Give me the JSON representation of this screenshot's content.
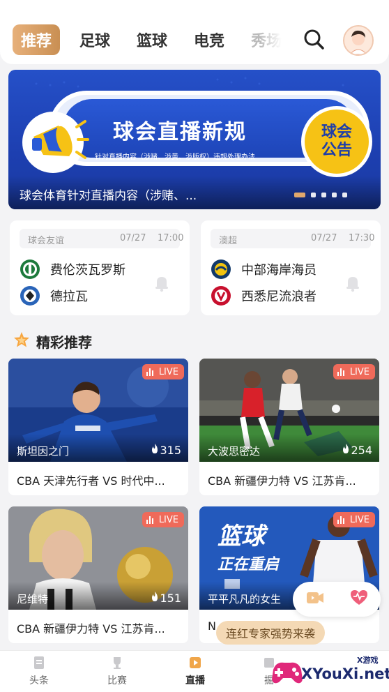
{
  "top_tabs": [
    "推荐",
    "足球",
    "篮球",
    "电竞",
    "秀场"
  ],
  "banner": {
    "title": "球会直播新规",
    "subtitle": "针对直播内容（涉赌、涉黄、涉版权）违规处理办法",
    "badge_line1": "球会",
    "badge_line2": "公告",
    "caption": "球会体育针对直播内容（涉赌、..."
  },
  "matches": [
    {
      "league": "球会友谊",
      "date": "07/27",
      "time": "17:00",
      "home": "费伦茨瓦罗斯",
      "away": "德拉瓦"
    },
    {
      "league": "澳超",
      "date": "07/27",
      "time": "17:30",
      "home": "中部海岸海员",
      "away": "西悉尼流浪者"
    }
  ],
  "section_title": "精彩推荐",
  "live_label": "LIVE",
  "videos": [
    {
      "anchor": "斯坦因之门",
      "heat": "315",
      "title": "CBA 天津先行者 VS 时代中..."
    },
    {
      "anchor": "大波思密达",
      "heat": "254",
      "title": "CBA 新疆伊力特 VS 江苏肯..."
    },
    {
      "anchor": "尼维特",
      "heat": "151",
      "title": "CBA 新疆伊力特 VS 江苏肯..."
    },
    {
      "anchor": "平平凡凡的女生",
      "heat": "",
      "title": "N"
    }
  ],
  "promo_text": "连红专家强势来袭",
  "bottom_nav": [
    "头条",
    "比赛",
    "直播",
    "掘"
  ],
  "watermark": {
    "text": "XYouXi.net",
    "small": "X游戏"
  },
  "colors": {
    "accent": "#d9a063",
    "live": "#ef6a5a",
    "banner": "#2550c8"
  }
}
